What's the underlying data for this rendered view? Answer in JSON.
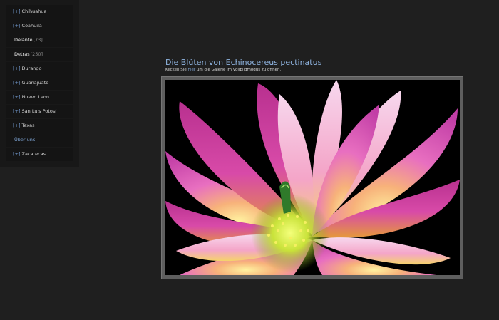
{
  "sidebar": {
    "items": [
      {
        "prefix": "[+]",
        "label": "Chihuahua",
        "count": ""
      },
      {
        "prefix": "[+]",
        "label": "Coahuila",
        "count": ""
      },
      {
        "prefix": "",
        "label": "Delante",
        "count": "[73]"
      },
      {
        "prefix": "",
        "label": "Detras",
        "count": "[250]"
      },
      {
        "prefix": "[+]",
        "label": "Durango",
        "count": ""
      },
      {
        "prefix": "[+]",
        "label": "Guanajuato",
        "count": ""
      },
      {
        "prefix": "[+]",
        "label": "Nuevo Leon",
        "count": ""
      },
      {
        "prefix": "[+]",
        "label": "San Luis Potosí",
        "count": ""
      },
      {
        "prefix": "[+]",
        "label": "Texas",
        "count": ""
      },
      {
        "prefix": "",
        "label": "Über uns",
        "count": ""
      },
      {
        "prefix": "[+]",
        "label": "Zacatecas",
        "count": ""
      }
    ]
  },
  "main": {
    "title": "Die Blüten von Echinocereus pectinatus",
    "subtitle_before": "Klicken Sie",
    "subtitle_link": "hier",
    "subtitle_after": "um die Galerie im Vollbildmodus zu öffnen."
  },
  "colors": {
    "background": "#1f1f1f",
    "sidebar": "#181818",
    "accent_link": "#7fa6d6",
    "title": "#8fb4e0",
    "frame": "#5e5e5e"
  },
  "photo": {
    "icon": "cactus-flower-photo"
  }
}
